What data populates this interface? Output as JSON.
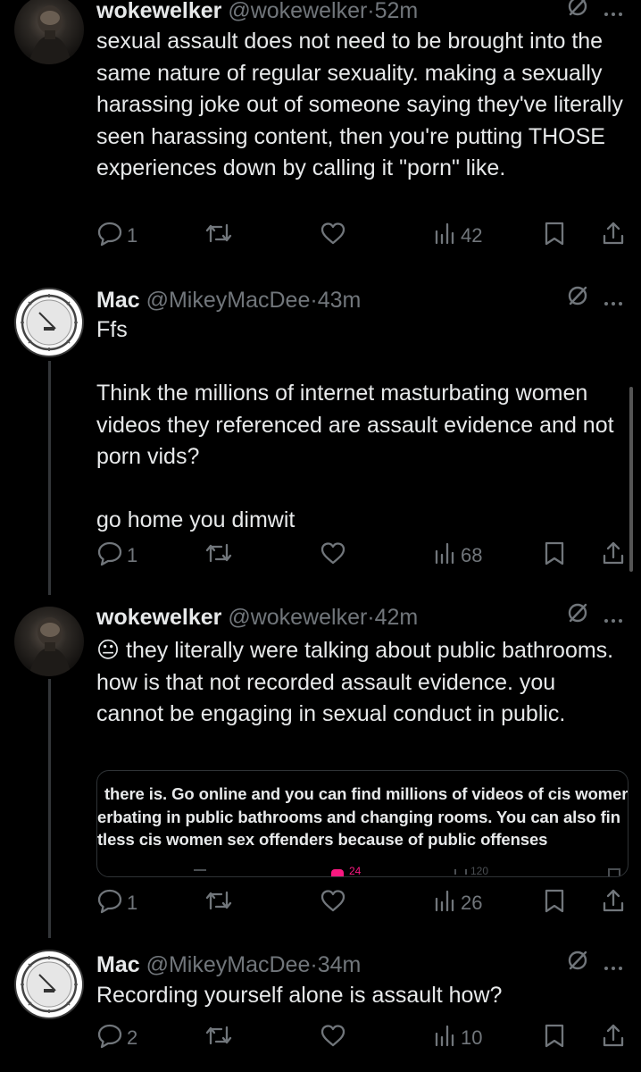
{
  "tweets": [
    {
      "name": "wokewelker",
      "handle": "@wokewelker",
      "sep": "·",
      "time": "52m",
      "text": "sexual assault does not need to be brought into the same nature of regular sexuality. making a sexually harassing joke out of someone saying they've literally seen harassing content, then you're putting THOSE experiences down by calling it \"porn\" like.",
      "replies": "1",
      "views": "42"
    },
    {
      "name": "Mac",
      "handle": "@MikeyMacDee",
      "sep": "·",
      "time": "43m",
      "text": "Ffs\n\nThink the millions of internet masturbating women videos they referenced are assault evidence and not porn vids?\n\ngo home you dimwit",
      "replies": "1",
      "views": "68"
    },
    {
      "name": "wokewelker",
      "handle": "@wokewelker",
      "sep": "·",
      "time": "42m",
      "emoji": "😐",
      "text": " they literally were talking about public bathrooms. how is that not recorded assault evidence. you cannot be engaging in sexual conduct in public.",
      "replies": "1",
      "views": "26",
      "quote": {
        "lines": [
          "there is. Go online and you can find millions of videos of cis womer",
          "erbating in public bathrooms and changing rooms. You can also fin",
          "tless cis women sex offenders because of public offenses"
        ],
        "likes": "24",
        "views": "120"
      }
    },
    {
      "name": "Mac",
      "handle": "@MikeyMacDee",
      "sep": "·",
      "time": "34m",
      "text": "Recording yourself alone is assault how?",
      "replies": "2",
      "views": "10"
    }
  ],
  "colors": {
    "background": "#000000",
    "text": "#e7e9ea",
    "muted": "#71767b",
    "like_pink": "#f91880"
  },
  "icons": [
    "grok-icon",
    "more-icon",
    "reply-icon",
    "retweet-icon",
    "like-icon",
    "views-icon",
    "bookmark-icon",
    "share-icon"
  ]
}
